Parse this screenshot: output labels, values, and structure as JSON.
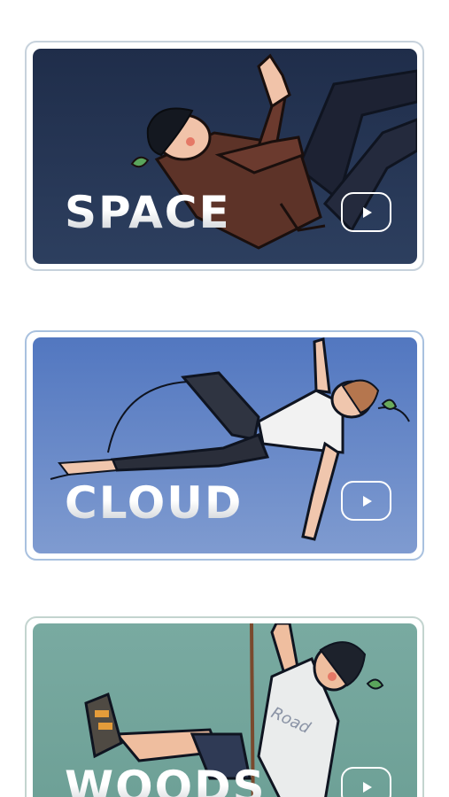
{
  "cards": [
    {
      "title": "SPACE",
      "theme": "space",
      "background_color": "#25355a",
      "play_icon": "play-icon"
    },
    {
      "title": "CLOUD",
      "theme": "cloud",
      "background_color": "#6487c8",
      "play_icon": "play-icon"
    },
    {
      "title": "WOODS",
      "theme": "woods",
      "background_color": "#74a69c",
      "play_icon": "play-icon",
      "shirt_text": "Road"
    }
  ]
}
